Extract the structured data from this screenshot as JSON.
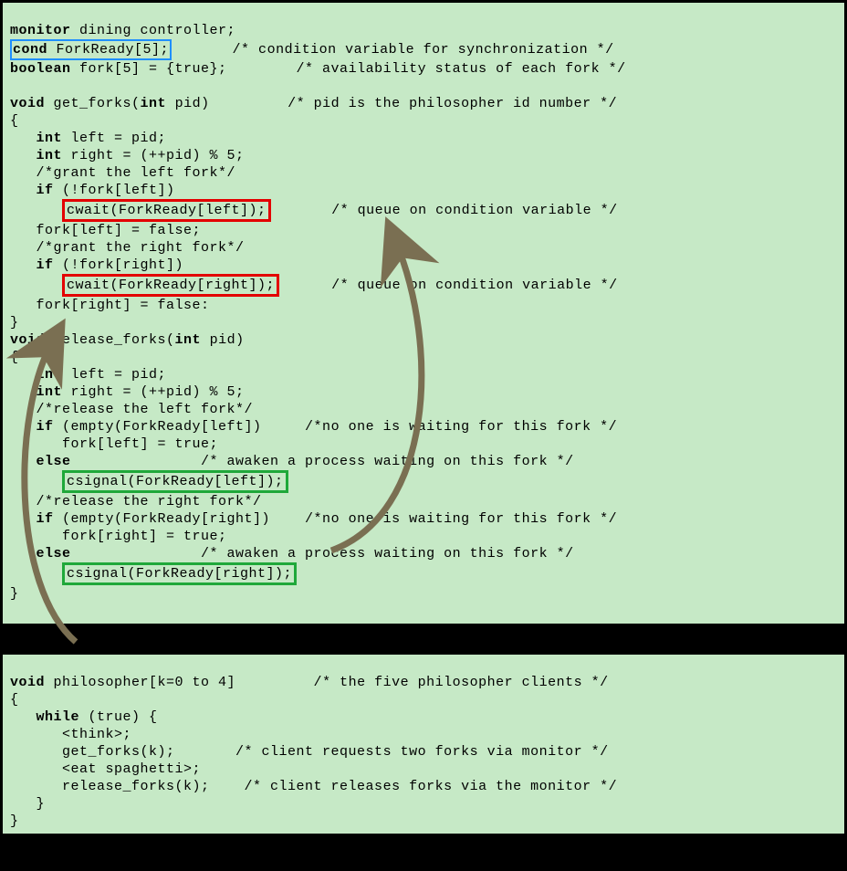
{
  "panel1": {
    "l01a": "monitor",
    "l01b": " dining controller;",
    "l02a": "cond",
    "l02b": " ForkReady[5];",
    "l02c": "       /* condition variable for synchronization */",
    "l03a": "boolean",
    "l03b": " fork[5] = {true};        /* availability status of each fork */",
    "l04": "",
    "l05a": "void",
    "l05b": " get_forks(",
    "l05c": "int",
    "l05d": " pid)         /* pid is the philosopher id number */",
    "l06": "{",
    "l07a": "   int",
    "l07b": " left = pid;",
    "l08a": "   int",
    "l08b": " right = (++pid) % 5;",
    "l09": "   /*grant the left fork*/",
    "l10a": "   if",
    "l10b": " (!fork[left])",
    "l11a": "      ",
    "l11b": "cwait(ForkReady[left]);",
    "l11c": "       /* queue on condition variable */",
    "l12": "   fork[left] = false;",
    "l13": "   /*grant the right fork*/",
    "l14a": "   if",
    "l14b": " (!fork[right])",
    "l15a": "      ",
    "l15b": "cwait(ForkReady[right]);",
    "l15c": "      /* queue on condition variable */",
    "l16": "   fork[right] = false:",
    "l17": "}",
    "l18a": "void",
    "l18b": " release_forks(",
    "l18c": "int",
    "l18d": " pid)",
    "l19": "{",
    "l20a": "   int",
    "l20b": " left = pid;",
    "l21a": "   int",
    "l21b": " right = (++pid) % 5;",
    "l22": "   /*release the left fork*/",
    "l23a": "   if",
    "l23b": " (empty(ForkReady[left])     /*no one is waiting for this fork */",
    "l24": "      fork[left] = true;",
    "l25a": "   else",
    "l25b": "               /* awaken a process waiting on this fork */",
    "l26a": "      ",
    "l26b": "csignal(ForkReady[left]);",
    "l27": "   /*release the right fork*/",
    "l28a": "   if",
    "l28b": " (empty(ForkReady[right])    /*no one is waiting for this fork */",
    "l29": "      fork[right] = true;",
    "l30a": "   else",
    "l30b": "               /* awaken a process waiting on this fork */",
    "l31a": "      ",
    "l31b": "csignal(ForkReady[right]);",
    "l32": "}"
  },
  "panel2": {
    "l01a": "void",
    "l01b": " philosopher[k=0 to 4]         /* the five philosopher clients */",
    "l02": "{",
    "l03a": "   while",
    "l03b": " (true) {",
    "l04": "      <think>;",
    "l05": "      get_forks(k);       /* client requests two forks via monitor */",
    "l06": "      <eat spaghetti>;",
    "l07": "      release_forks(k);    /* client releases forks via the monitor */",
    "l08": "   }",
    "l09": "}"
  }
}
